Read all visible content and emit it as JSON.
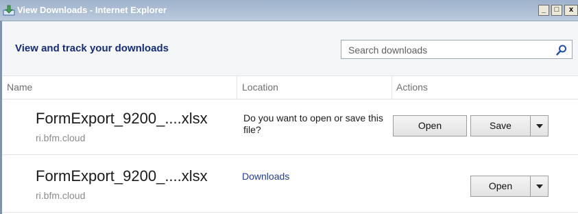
{
  "window": {
    "title": "View Downloads - Internet Explorer",
    "controls": {
      "minimize": "_",
      "maximize": "□",
      "close": "x"
    }
  },
  "header": {
    "title": "View and track your downloads",
    "search": {
      "placeholder": "Search downloads",
      "value": ""
    }
  },
  "columns": {
    "name": "Name",
    "location": "Location",
    "actions": "Actions"
  },
  "downloads": [
    {
      "filename": "FormExport_9200_....xlsx",
      "host": "ri.bfm.cloud",
      "location_prompt": "Do you want to open or save this file?",
      "actions": {
        "open": "Open",
        "save": "Save"
      }
    },
    {
      "filename": "FormExport_9200_....xlsx",
      "host": "ri.bfm.cloud",
      "location_link": "Downloads",
      "actions": {
        "open": "Open"
      }
    }
  ],
  "colors": {
    "title_blue": "#142c7a",
    "link_blue": "#1f3d9a",
    "titlebar": "#9db2cc"
  },
  "icons": [
    "ie-download-icon",
    "search-icon",
    "dropdown-caret-icon"
  ]
}
